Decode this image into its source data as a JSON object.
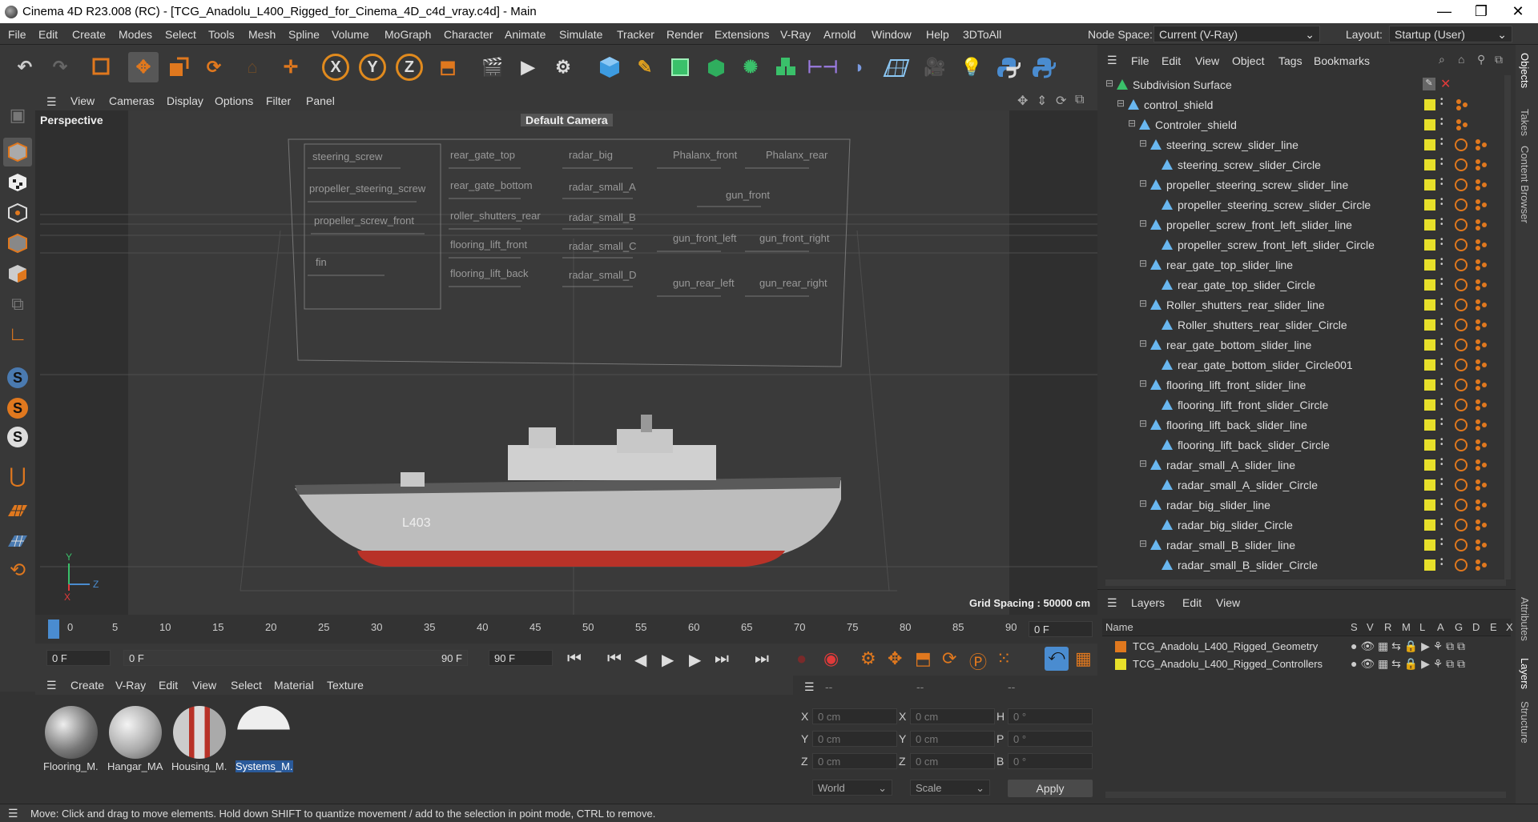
{
  "titlebar": {
    "title": "Cinema 4D R23.008 (RC) - [TCG_Anadolu_L400_Rigged_for_Cinema_4D_c4d_vray.c4d] - Main",
    "minimize": "—",
    "maximize": "❐",
    "close": "✕"
  },
  "menu": [
    "File",
    "Edit",
    "Create",
    "Modes",
    "Select",
    "Tools",
    "Mesh",
    "Spline",
    "Volume",
    "MoGraph",
    "Character",
    "Animate",
    "Simulate",
    "Tracker",
    "Render",
    "Extensions",
    "V-Ray",
    "Arnold",
    "Window",
    "Help",
    "3DToAll"
  ],
  "node_space": {
    "label": "Node Space:",
    "value": "Current (V-Ray)"
  },
  "layout": {
    "label": "Layout:",
    "value": "Startup (User)"
  },
  "toolbar": {
    "x": "X",
    "y": "Y",
    "z": "Z"
  },
  "viewport": {
    "menu": [
      "View",
      "Cameras",
      "Display",
      "Options",
      "Filter",
      "Panel"
    ],
    "name": "Perspective",
    "camera": "Default Camera",
    "grid_spacing": "Grid Spacing : 50000 cm",
    "axis_y": "Y",
    "axis_z": "Z",
    "axis_x": "X",
    "hull_text": "L403",
    "controls": [
      "steering_screw",
      "propeller_steering_screw",
      "propeller_screw_front",
      "fin",
      "rear_gate_top",
      "rear_gate_bottom",
      "roller_shutters_rear",
      "flooring_lift_front",
      "flooring_lift_back",
      "radar_big",
      "radar_small_A",
      "radar_small_B",
      "radar_small_C",
      "radar_small_D",
      "Phalanx_front",
      "Phalanx_rear",
      "gun_front",
      "gun_front_left",
      "gun_front_right",
      "gun_rear_left",
      "gun_rear_right"
    ]
  },
  "timeline": {
    "ticks": [
      "0",
      "5",
      "10",
      "15",
      "20",
      "25",
      "30",
      "35",
      "40",
      "45",
      "50",
      "55",
      "60",
      "65",
      "70",
      "75",
      "80",
      "85",
      "90"
    ],
    "current": "0 F"
  },
  "transport": {
    "start": "0 F",
    "range_start": "0 F",
    "range_end": "90 F",
    "end": "90 F"
  },
  "materials": {
    "menu": [
      "Create",
      "V-Ray",
      "Edit",
      "View",
      "Select",
      "Material",
      "Texture"
    ],
    "items": [
      "Flooring_M.",
      "Hangar_MA",
      "Housing_M.",
      "Systems_M."
    ]
  },
  "coords": {
    "headers": [
      "--",
      "--",
      "--"
    ],
    "rows": [
      [
        "X",
        "0 cm",
        "X",
        "0 cm",
        "H",
        "0 °"
      ],
      [
        "Y",
        "0 cm",
        "Y",
        "0 cm",
        "P",
        "0 °"
      ],
      [
        "Z",
        "0 cm",
        "Z",
        "0 cm",
        "B",
        "0 °"
      ]
    ],
    "world": "World",
    "scale": "Scale",
    "apply": "Apply"
  },
  "status": "Move: Click and drag to move elements. Hold down SHIFT to quantize movement / add to the selection in point mode, CTRL to remove.",
  "objects": {
    "menu": [
      "File",
      "Edit",
      "View",
      "Object",
      "Tags",
      "Bookmarks"
    ],
    "rows": [
      "Subdivision Surface",
      "control_shield",
      "Controler_shield",
      "steering_screw_slider_line",
      "steering_screw_slider_Circle",
      "propeller_steering_screw_slider_line",
      "propeller_steering_screw_slider_Circle",
      "propeller_screw_front_left_slider_line",
      "propeller_screw_front_left_slider_Circle",
      "rear_gate_top_slider_line",
      "rear_gate_top_slider_Circle",
      "Roller_shutters_rear_slider_line",
      "Roller_shutters_rear_slider_Circle",
      "rear_gate_bottom_slider_line",
      "rear_gate_bottom_slider_Circle001",
      "flooring_lift_front_slider_line",
      "flooring_lift_front_slider_Circle",
      "flooring_lift_back_slider_line",
      "flooring_lift_back_slider_Circle",
      "radar_small_A_slider_line",
      "radar_small_A_slider_Circle",
      "radar_big_slider_line",
      "radar_big_slider_Circle",
      "radar_small_B_slider_line",
      "radar_small_B_slider_Circle"
    ]
  },
  "layers": {
    "menu": [
      "Layers",
      "Edit",
      "View"
    ],
    "columns": [
      "Name",
      "S",
      "V",
      "R",
      "M",
      "L",
      "A",
      "G",
      "D",
      "E",
      "X"
    ],
    "rows": [
      {
        "name": "TCG_Anadolu_L400_Rigged_Geometry",
        "color": "#e0781e"
      },
      {
        "name": "TCG_Anadolu_L400_Rigged_Controllers",
        "color": "#e8e02a"
      }
    ]
  },
  "sidetabs": [
    "Objects",
    "Takes",
    "Content Browser",
    "Attributes",
    "Layers",
    "Structure"
  ],
  "colors": {
    "accent": "#e0781e",
    "object_icon": "#69b7f0",
    "layer_yellow": "#e8e02a",
    "hull_red": "#b83228"
  }
}
